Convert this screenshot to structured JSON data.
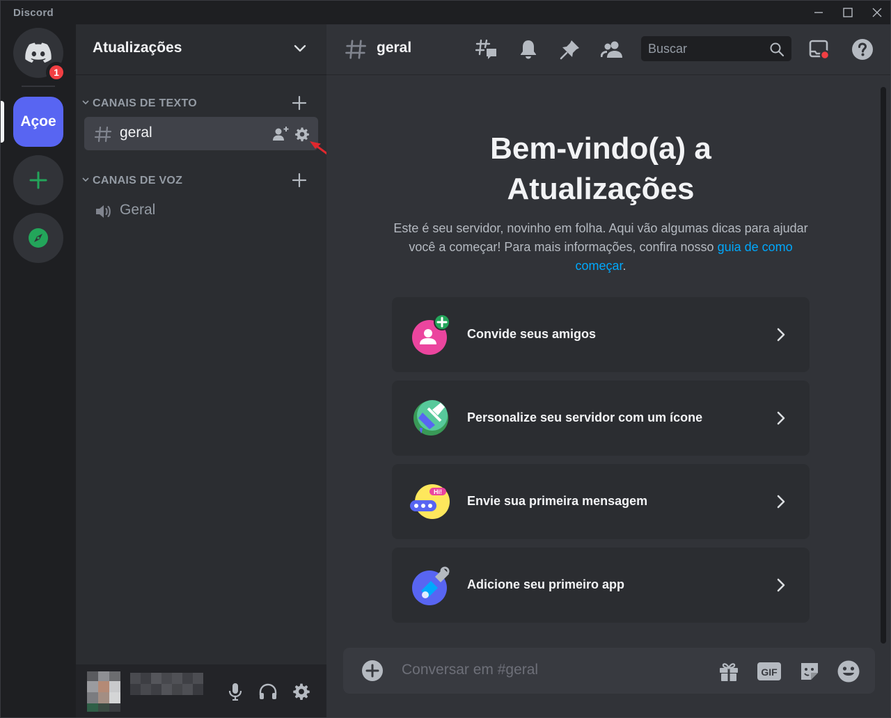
{
  "window": {
    "app_title": "Discord"
  },
  "rail": {
    "home_badge": "1",
    "server_abbrev": "Açoe"
  },
  "sidebar": {
    "server_name": "Atualizações",
    "categories": [
      {
        "label": "CANAIS DE TEXTO"
      },
      {
        "label": "CANAIS DE VOZ"
      }
    ],
    "text_channels": [
      {
        "name": "geral"
      }
    ],
    "voice_channels": [
      {
        "name": "Geral"
      }
    ]
  },
  "header": {
    "channel_name": "geral",
    "search_placeholder": "Buscar"
  },
  "welcome": {
    "title_line1": "Bem-vindo(a) a",
    "title_line2": "Atualizações",
    "desc_text": "Este é seu servidor, novinho em folha. Aqui vão algumas dicas para ajudar você a começar! Para mais informações, confira nosso ",
    "desc_link": "guia de como começar",
    "desc_end": ".",
    "cards": [
      {
        "label": "Convide seus amigos"
      },
      {
        "label": "Personalize seu servidor com um ícone"
      },
      {
        "label": "Envie sua primeira mensagem"
      },
      {
        "label": "Adicione seu primeiro app"
      }
    ],
    "hi_bubble": "Hi!"
  },
  "composer": {
    "placeholder": "Conversar em #geral",
    "gif_label": "GIF"
  },
  "colors": {
    "blurple": "#5865f2",
    "green": "#23a55a",
    "red": "#f23f43",
    "link": "#00a8fc"
  }
}
